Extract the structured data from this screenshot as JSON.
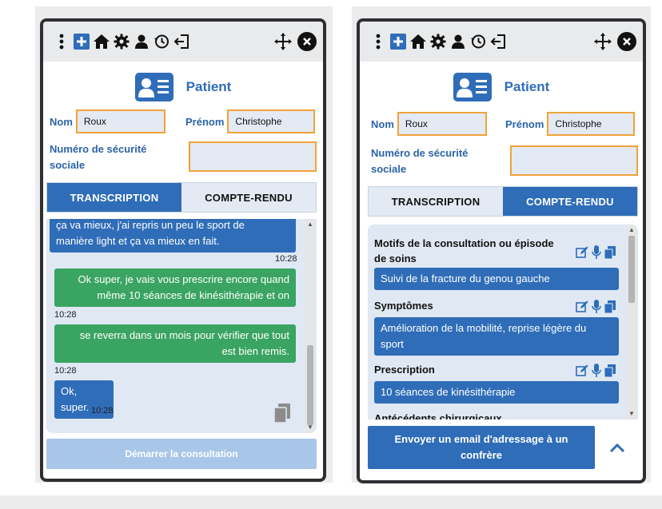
{
  "left_panel": {
    "patient_title": "Patient",
    "nom_label": "Nom",
    "nom_value": "Roux",
    "prenom_label": "Prénom",
    "prenom_value": "Christophe",
    "secu_label_line1": "Numéro de sécurité",
    "secu_label_line2": "sociale",
    "secu_value": "",
    "tabs": [
      {
        "label": "TRANSCRIPTION",
        "active": true
      },
      {
        "label": "COMPTE-RENDU",
        "active": false
      }
    ],
    "messages": [
      {
        "side": "doctor",
        "line1": "ça va mieux, j'ai repris un peu le sport de",
        "line2": "manière light et ça va mieux en fait.",
        "time": "10:28"
      },
      {
        "side": "patient",
        "line1": "Ok super, je vais vous prescrire encore quand",
        "line2": "même 10 séances de kinésithérapie et on",
        "time": "10:28"
      },
      {
        "side": "patient",
        "line1": "se reverra dans un mois pour vérifier que tout",
        "line2": "est bien remis.",
        "time": "10:28"
      },
      {
        "side": "doctor",
        "line1": "Ok, super.",
        "time": "10:28"
      }
    ],
    "start_button": "Démarrer la consultation"
  },
  "right_panel": {
    "patient_title": "Patient",
    "nom_label": "Nom",
    "nom_value": "Roux",
    "prenom_label": "Prénom",
    "prenom_value": "Christophe",
    "secu_label_line1": "Numéro de sécurité",
    "secu_label_line2": "sociale",
    "secu_value": "",
    "tabs": [
      {
        "label": "TRANSCRIPTION",
        "active": false
      },
      {
        "label": "COMPTE-RENDU",
        "active": true
      }
    ],
    "sections": [
      {
        "title_line1": "Motifs de la consultation ou épisode",
        "title_line2": "de soins",
        "value_line1": "Suivi de la fracture du genou gauche"
      },
      {
        "title_line1": "Symptômes",
        "value_line1": "Amélioration de la mobilité, reprise légère du",
        "value_line2": "sport"
      },
      {
        "title_line1": "Prescription",
        "value_line1": "10 séances de kinésithérapie"
      },
      {
        "title_line1": "Antécédents chirurgicaux"
      }
    ],
    "email_button_line1": "Envoyer un email d'adressage à un",
    "email_button_line2": "confrère"
  },
  "colors": {
    "primary_blue": "#2f6db8",
    "green_bubble": "#3aa462",
    "field_border": "#f0a23a",
    "field_bg": "#e3eaf3",
    "disabled_button": "#a8c6e8"
  },
  "icons": [
    "more-vertical-icon",
    "add-note-icon",
    "home-icon",
    "gear-icon",
    "user-icon",
    "history-icon",
    "logout-icon",
    "move-icon",
    "close-icon",
    "id-card-icon",
    "edit-icon",
    "microphone-icon",
    "copy-icon",
    "chevron-up-icon"
  ]
}
